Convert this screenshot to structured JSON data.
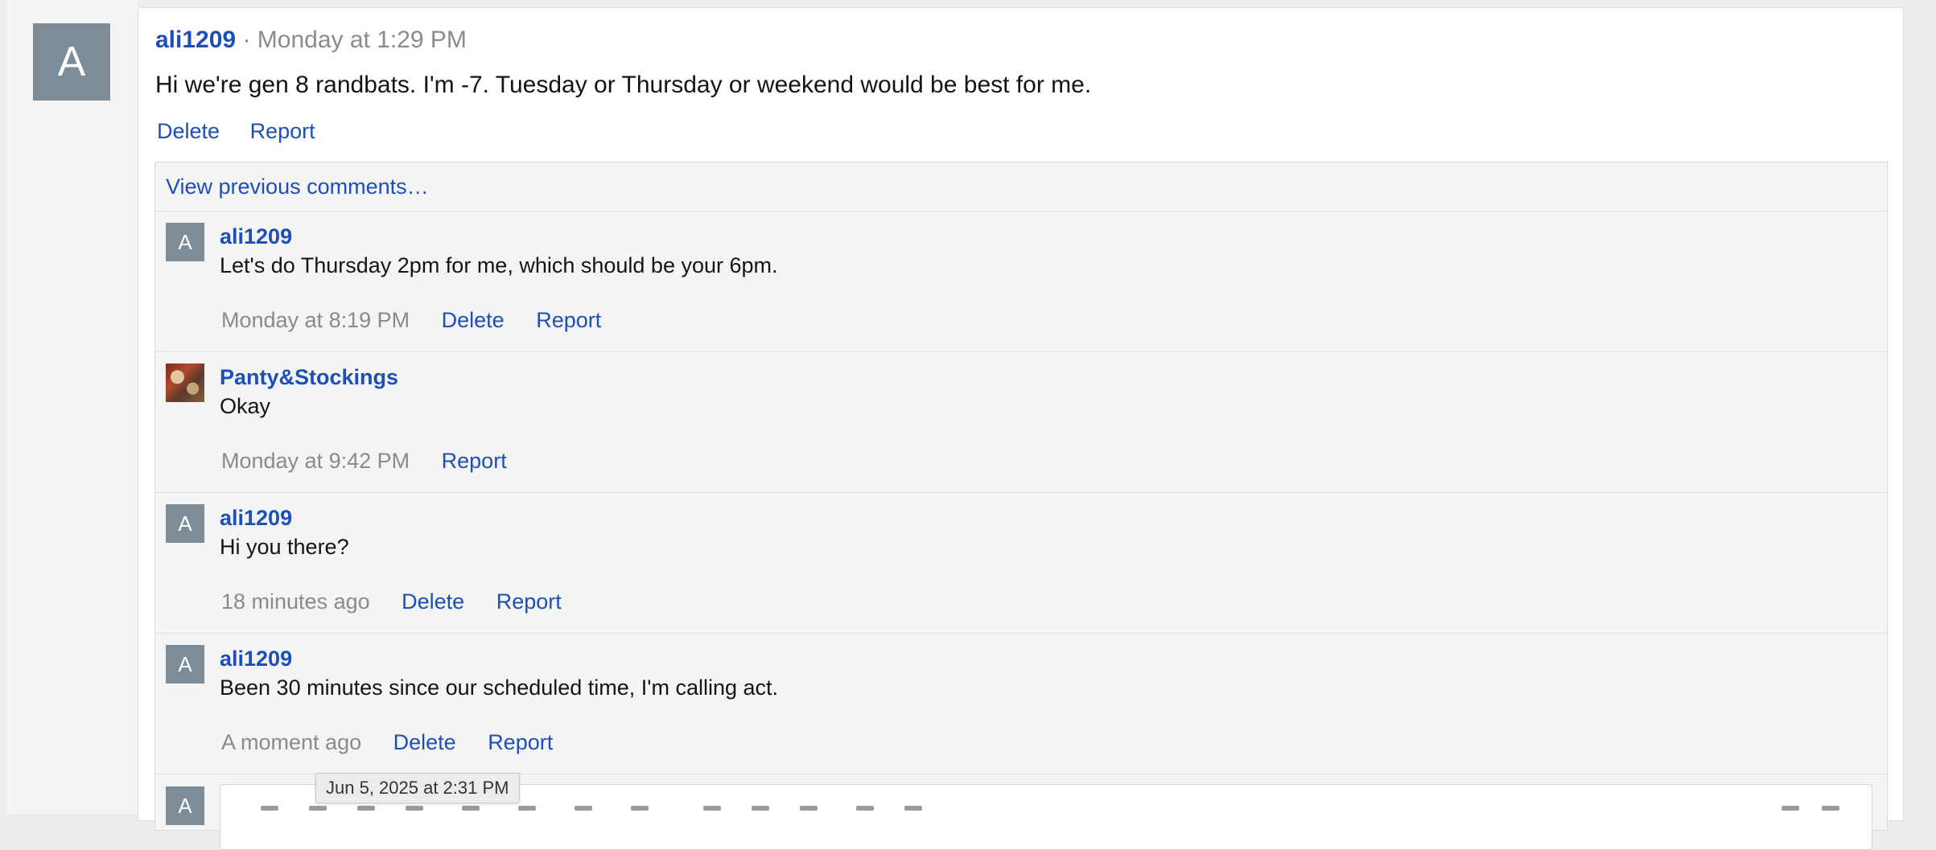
{
  "post": {
    "avatar_letter": "A",
    "username": "ali1209",
    "separator": "·",
    "time": "Monday at 1:29 PM",
    "body": "Hi we're gen 8 randbats. I'm -7. Tuesday or Thursday or weekend would be best for me.",
    "delete_label": "Delete",
    "report_label": "Report"
  },
  "comments": {
    "view_previous": "View previous comments…",
    "items": [
      {
        "avatar_letter": "A",
        "username": "ali1209",
        "text": "Let's do Thursday 2pm for me, which should be your 6pm.",
        "time": "Monday at 8:19 PM",
        "delete_label": "Delete",
        "report_label": "Report"
      },
      {
        "username": "Panty&Stockings",
        "text": "Okay",
        "time": "Monday at 9:42 PM",
        "report_label": "Report"
      },
      {
        "avatar_letter": "A",
        "username": "ali1209",
        "text": "Hi you there?",
        "time": "18 minutes ago",
        "delete_label": "Delete",
        "report_label": "Report"
      },
      {
        "avatar_letter": "A",
        "username": "ali1209",
        "text": "Been 30 minutes since our scheduled time, I'm calling act.",
        "time": "A moment ago",
        "delete_label": "Delete",
        "report_label": "Report"
      }
    ],
    "reply_avatar_letter": "A"
  },
  "tooltip": {
    "text": "Jun 5, 2025 at 2:31 PM"
  },
  "colors": {
    "link": "#1c4fb7",
    "avatar_bg": "#7d8c99",
    "muted_text": "#8a8a8a"
  }
}
